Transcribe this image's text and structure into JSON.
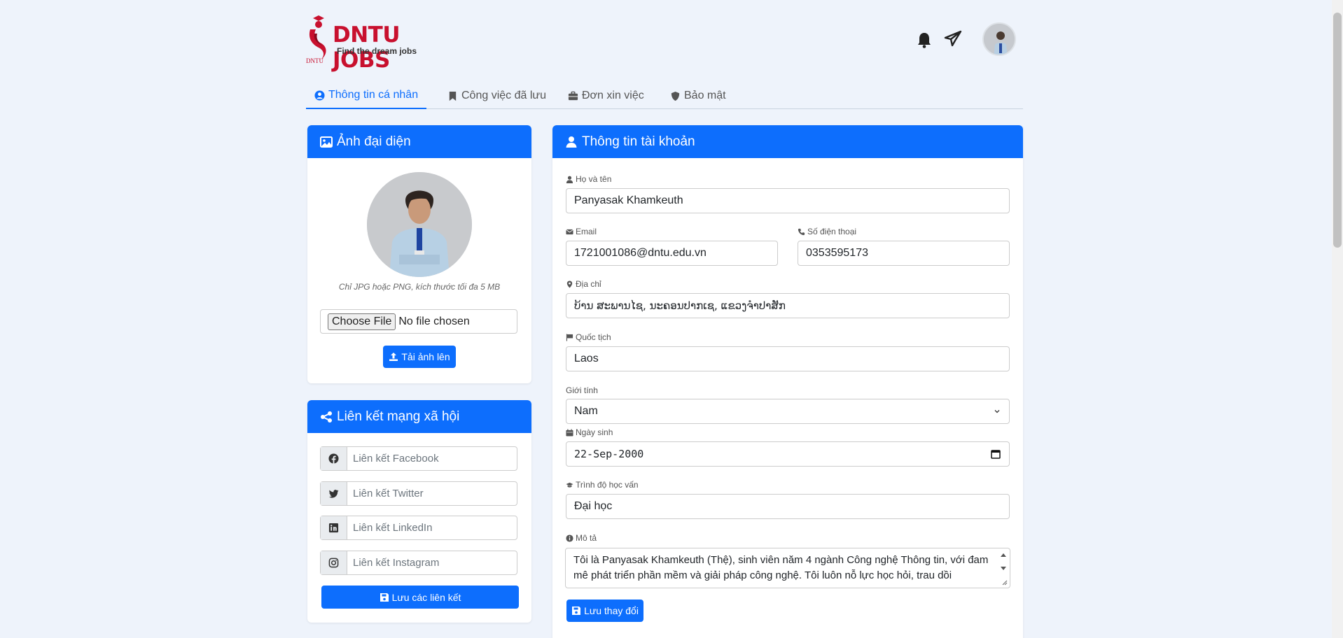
{
  "brand": {
    "title": "DNTU JOBS",
    "tagline": "Find the dream jobs",
    "small_text": "DNTU",
    "colors": {
      "primary": "#0d6efd",
      "brand_red": "#c8102e"
    }
  },
  "header": {
    "icons": [
      "bell-icon",
      "send-icon",
      "avatar"
    ]
  },
  "tabs": [
    {
      "label": "Thông tin cá nhân",
      "icon": "user-circle-icon",
      "active": true
    },
    {
      "label": "Công việc đã lưu",
      "icon": "bookmark-icon",
      "active": false
    },
    {
      "label": "Đơn xin việc",
      "icon": "briefcase-icon",
      "active": false
    },
    {
      "label": "Bảo mật",
      "icon": "shield-icon",
      "active": false
    }
  ],
  "avatar_card": {
    "title": "Ảnh đại diện",
    "hint": "Chỉ JPG hoặc PNG, kích thước tối đa 5 MB",
    "file_button": "Choose File",
    "file_status": "No file chosen",
    "upload_label": "Tải ảnh lên"
  },
  "social_card": {
    "title": "Liên kết mạng xã hội",
    "links": [
      {
        "icon": "facebook-icon",
        "placeholder": "Liên kết Facebook"
      },
      {
        "icon": "twitter-icon",
        "placeholder": "Liên kết Twitter"
      },
      {
        "icon": "linkedin-icon",
        "placeholder": "Liên kết LinkedIn"
      },
      {
        "icon": "instagram-icon",
        "placeholder": "Liên kết Instagram"
      }
    ],
    "save_label": "Lưu các liên kết"
  },
  "account_card": {
    "title": "Thông tin tài khoản",
    "fields": {
      "name": {
        "label": "Họ và tên",
        "value": "Panyasak Khamkeuth"
      },
      "email": {
        "label": "Email",
        "value": "1721001086@dntu.edu.vn"
      },
      "phone": {
        "label": "Số điện thoại",
        "value": "0353595173"
      },
      "address": {
        "label": "Địa chỉ",
        "value": "ບ້ານ ສະພານໄຊ, ນະຄອນປາກເຊ, ແຂວງຈຳປາສັກ"
      },
      "nationality": {
        "label": "Quốc tịch",
        "value": "Laos"
      },
      "gender": {
        "label": "Giới tính",
        "value": "Nam"
      },
      "birthday": {
        "label": "Ngày sinh",
        "value": "22-Sep-2000"
      },
      "education": {
        "label": "Trình độ học vấn",
        "value": "Đại học"
      },
      "description": {
        "label": "Mô tả",
        "value": "Tôi là Panyasak Khamkeuth (Thệ), sinh viên năm 4 ngành Công nghệ Thông tin, với đam mê phát triển phần mềm và giải pháp công nghệ. Tôi luôn nỗ lực học hỏi, trau dồi"
      }
    },
    "save_label": "Lưu thay đổi"
  }
}
